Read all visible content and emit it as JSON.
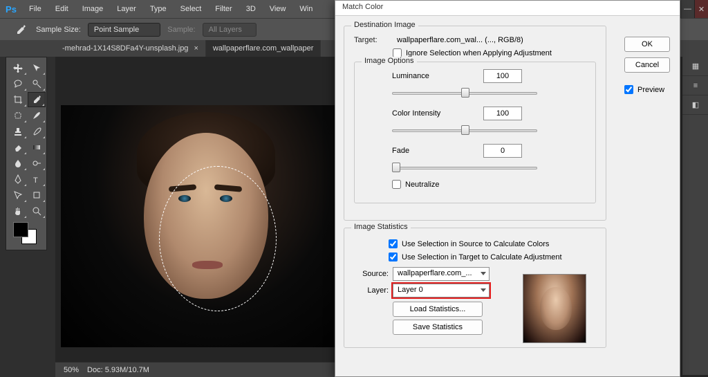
{
  "app": {
    "logo": "Ps"
  },
  "menu": [
    "File",
    "Edit",
    "Image",
    "Layer",
    "Type",
    "Select",
    "Filter",
    "3D",
    "View",
    "Win"
  ],
  "window_controls": {
    "min": "—",
    "close": "✕"
  },
  "options": {
    "sample_size_label": "Sample Size:",
    "sample_size_value": "Point Sample",
    "sample_label": "Sample:",
    "sample_value": "All Layers"
  },
  "tabs": [
    {
      "label": "-mehrad-1X14S8DFa4Y-unsplash.jpg",
      "active": false
    },
    {
      "label": "wallpaperflare.com_wallpaper",
      "active": true
    }
  ],
  "status": {
    "zoom": "50%",
    "doc": "Doc: 5.93M/10.7M"
  },
  "dialog": {
    "title": "Match Color",
    "buttons": {
      "ok": "OK",
      "cancel": "Cancel"
    },
    "preview_label": "Preview",
    "preview_checked": true,
    "dest": {
      "group": "Destination Image",
      "target_label": "Target:",
      "target_value": "wallpaperflare.com_wal... (..., RGB/8)",
      "ignore_label": "Ignore Selection when Applying Adjustment",
      "ignore_checked": false
    },
    "image_options": {
      "group": "Image Options",
      "luminance_label": "Luminance",
      "luminance_value": "100",
      "intensity_label": "Color Intensity",
      "intensity_value": "100",
      "fade_label": "Fade",
      "fade_value": "0",
      "neutralize_label": "Neutralize",
      "neutralize_checked": false
    },
    "stats": {
      "group": "Image Statistics",
      "use_src_label": "Use Selection in Source to Calculate Colors",
      "use_src_checked": true,
      "use_tgt_label": "Use Selection in Target to Calculate Adjustment",
      "use_tgt_checked": true,
      "source_label": "Source:",
      "source_value": "wallpaperflare.com_...",
      "layer_label": "Layer:",
      "layer_value": "Layer 0",
      "load_btn": "Load Statistics...",
      "save_btn": "Save Statistics"
    }
  }
}
